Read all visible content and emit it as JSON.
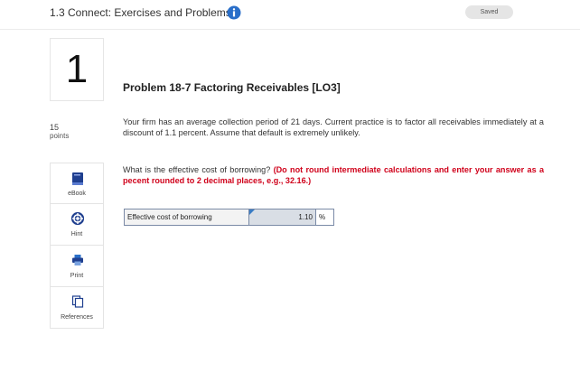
{
  "header": {
    "title": "1.3 Connect: Exercises and Problems",
    "saved_label": "Saved"
  },
  "question": {
    "number": "1",
    "points_value": "15",
    "points_label": "points"
  },
  "tools": [
    {
      "label": "eBook",
      "icon": "book-icon"
    },
    {
      "label": "Hint",
      "icon": "lifebuoy-icon"
    },
    {
      "label": "Print",
      "icon": "printer-icon"
    },
    {
      "label": "References",
      "icon": "documents-icon"
    }
  ],
  "problem": {
    "heading": "Problem 18-7 Factoring Receivables [LO3]",
    "text": "Your firm has an average collection period of 21 days. Current practice is to factor all receivables immediately at a discount of 1.1 percent. Assume that default is extremely unlikely.",
    "question": "What is the effective cost of borrowing?",
    "instruction": "(Do not round intermediate calculations and enter your answer as a pecent rounded to 2 decimal places, e.g., 32.16.)"
  },
  "answer": {
    "label": "Effective cost of borrowing",
    "value": "1.10",
    "unit": "%"
  },
  "colors": {
    "accent_blue": "#2a6fc9",
    "instruction_red": "#d0021b",
    "input_fill": "#d9dee5"
  }
}
